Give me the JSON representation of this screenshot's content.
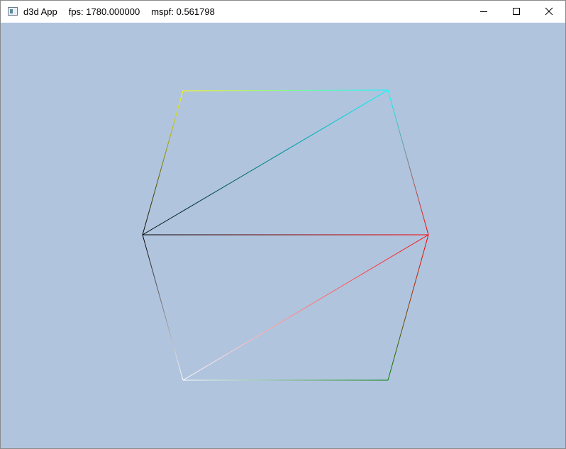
{
  "window": {
    "app_name": "d3d App",
    "fps_text": "fps: 1780.000000",
    "mspf_text": "mspf: 0.561798",
    "minimize_icon": "minimize-icon",
    "maximize_icon": "maximize-icon",
    "close_icon": "close-icon",
    "app_icon": "window-app-icon"
  },
  "viewport": {
    "background_color": "#b0c4de",
    "shape": "hexagon wireframe",
    "vertex_colors": {
      "top_left": "#ffff00",
      "top_right": "#00ffff",
      "right": "#ff0000",
      "bottom_right": "#008000",
      "bottom_left": "#ffffff",
      "left": "#000000"
    }
  }
}
